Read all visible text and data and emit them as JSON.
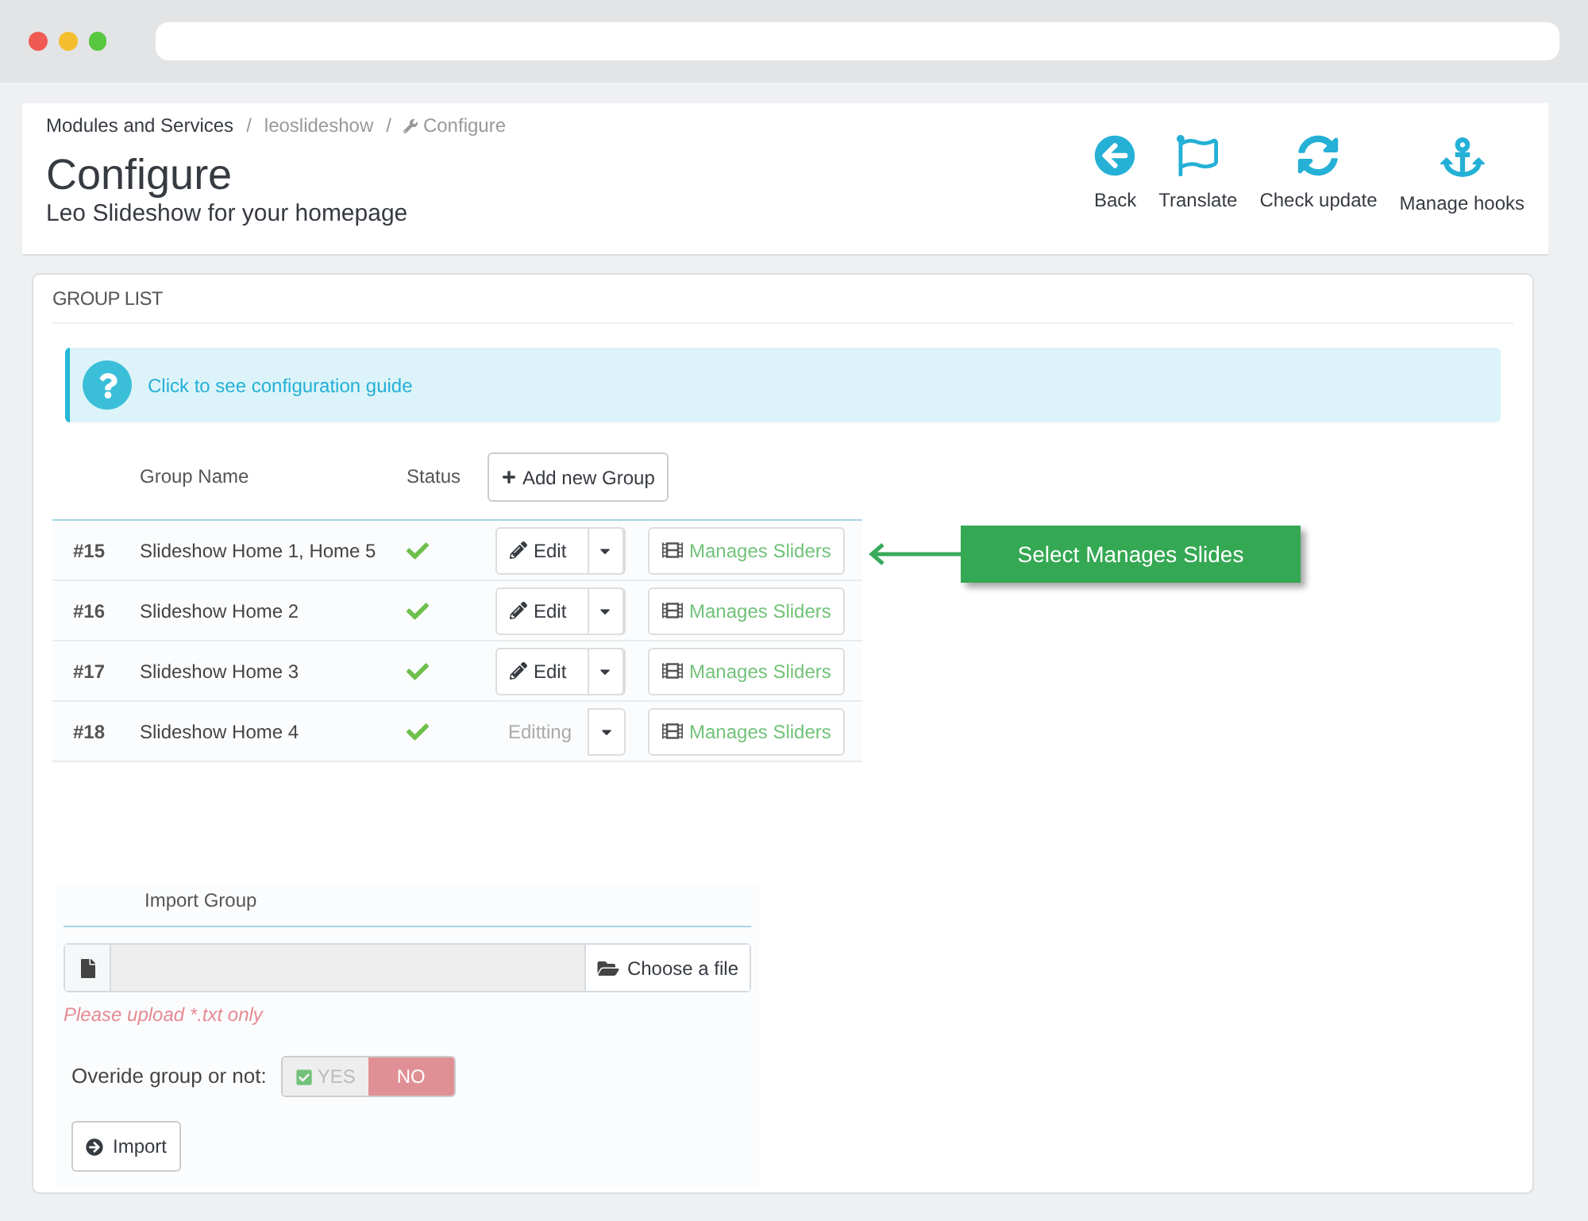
{
  "breadcrumb": [
    {
      "label": "Modules and Services",
      "icon": false
    },
    {
      "label": "leoslideshow",
      "icon": false
    },
    {
      "label": "Configure",
      "icon": true
    }
  ],
  "breadcrumb_separator": "/",
  "page_title": "Configure",
  "page_subtitle": "Leo Slideshow for your homepage",
  "toolbar": [
    {
      "label": "Back",
      "kind": "back"
    },
    {
      "label": "Translate",
      "kind": "flag"
    },
    {
      "label": "Check update",
      "kind": "refresh"
    },
    {
      "label": "Manage hooks",
      "kind": "anchor"
    }
  ],
  "panel_title": "GROUP LIST",
  "info_link": "Click to see configuration guide",
  "table": {
    "columns": [
      "Group Name",
      "Status"
    ],
    "add_button": "Add new Group",
    "rows": [
      {
        "id": "#15",
        "name": "Slideshow Home 1, Home 5",
        "enabled": true,
        "edit": "Edit",
        "editing": false,
        "manage": "Manages Sliders"
      },
      {
        "id": "#16",
        "name": "Slideshow Home 2",
        "enabled": true,
        "edit": "Edit",
        "editing": false,
        "manage": "Manages Sliders"
      },
      {
        "id": "#17",
        "name": "Slideshow Home 3",
        "enabled": true,
        "edit": "Edit",
        "editing": false,
        "manage": "Manages Sliders"
      },
      {
        "id": "#18",
        "name": "Slideshow Home 4",
        "enabled": true,
        "edit": "Editting",
        "editing": true,
        "manage": "Manages Sliders"
      }
    ]
  },
  "callout": "Select Manages Slides",
  "import": {
    "title": "Import Group",
    "choose_button": "Choose a file",
    "hint": "Please upload *.txt only",
    "override_label": "Overide group or not:",
    "options": [
      {
        "label": "YES",
        "selected": false
      },
      {
        "label": "NO",
        "selected": true
      }
    ],
    "import_button": "Import"
  }
}
